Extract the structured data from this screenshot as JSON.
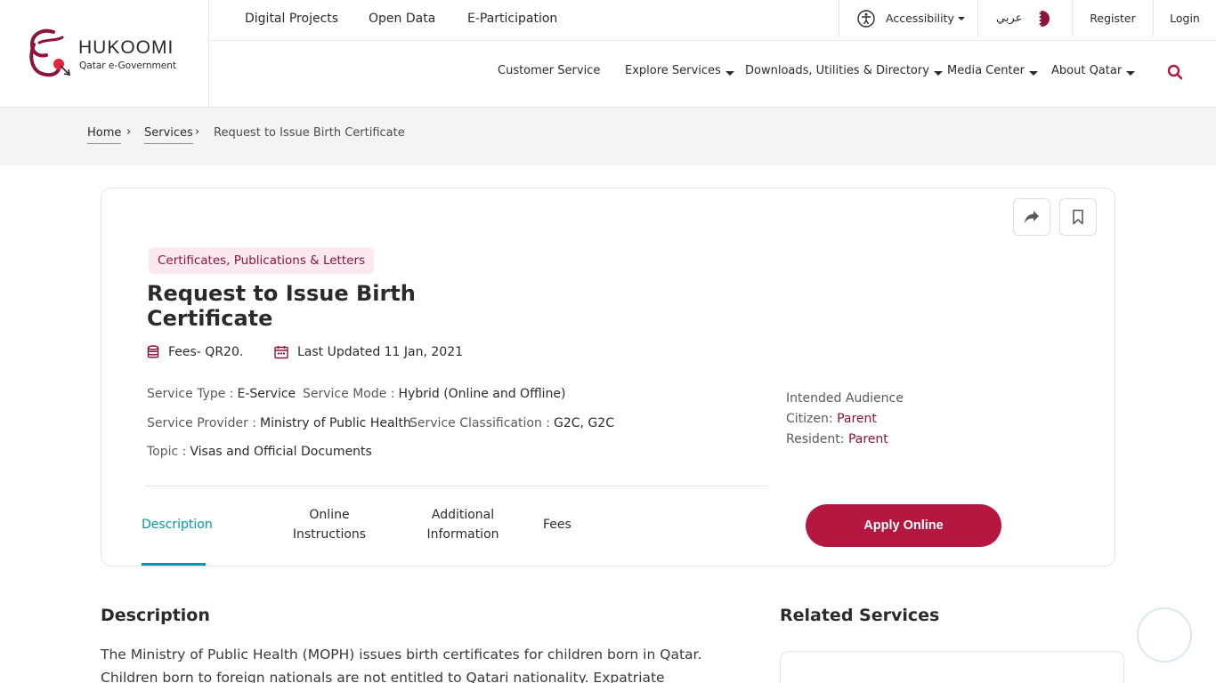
{
  "header": {
    "logo_title": "HUKOOMI",
    "logo_subtitle": "Qatar e-Government",
    "top_links": [
      "Digital Projects",
      "Open Data",
      "E-Participation"
    ],
    "accessibility_label": "Accessibility",
    "language_label": "عربي",
    "register_label": "Register",
    "login_label": "Login",
    "nav": {
      "customer_service": "Customer Service",
      "explore_services": "Explore Services",
      "downloads": "Downloads, Utilities & Directory",
      "media_center": "Media Center",
      "about_qatar": "About Qatar"
    }
  },
  "breadcrumb": {
    "home": "Home",
    "services": "Services",
    "current": "Request to Issue Birth Certificate",
    "separator": "›"
  },
  "service": {
    "category": "Certificates, Publications & Letters",
    "title": "Request to Issue Birth Certificate",
    "fees": "Fees- QR20.",
    "last_updated": "Last Updated 11 Jan, 2021",
    "attributes": {
      "service_type_label": "Service Type :",
      "service_type_value": "E-Service",
      "service_mode_label": "Service Mode :",
      "service_mode_value": "Hybrid (Online and Offline)",
      "service_provider_label": "Service Provider :",
      "service_provider_value": "Ministry of Public Health",
      "service_classification_label": "Service Classification :",
      "service_classification_value": "G2C, G2C",
      "topic_label": "Topic :",
      "topic_value": "Visas and Official Documents"
    },
    "audience": {
      "heading": "Intended Audience",
      "citizen_label": "Citizen:",
      "citizen_value": "Parent",
      "resident_label": "Resident:",
      "resident_value": "Parent"
    },
    "tabs": {
      "description": "Description",
      "online_line1": "Online",
      "online_line2": "Instructions",
      "additional_line1": "Additional",
      "additional_line2": "Information",
      "fees": "Fees"
    },
    "apply_label": "Apply Online"
  },
  "description": {
    "heading": "Description",
    "text": "The Ministry of Public Health (MOPH) issues birth certificates for children born in Qatar. Children born to foreign nationals are not entitled to Qatari nationality. Expatriate"
  },
  "related": {
    "heading": "Related Services"
  },
  "colors": {
    "brand": "#8a1538",
    "button": "#b4173f",
    "active_tab": "#0097a7",
    "breadcrumb_bg": "#f5f4f2"
  },
  "icons": [
    "hukoomi-logo-icon",
    "accessibility-icon",
    "qatar-flag-icon",
    "search-icon",
    "share-icon",
    "bookmark-icon",
    "coins-icon",
    "calendar-icon"
  ]
}
